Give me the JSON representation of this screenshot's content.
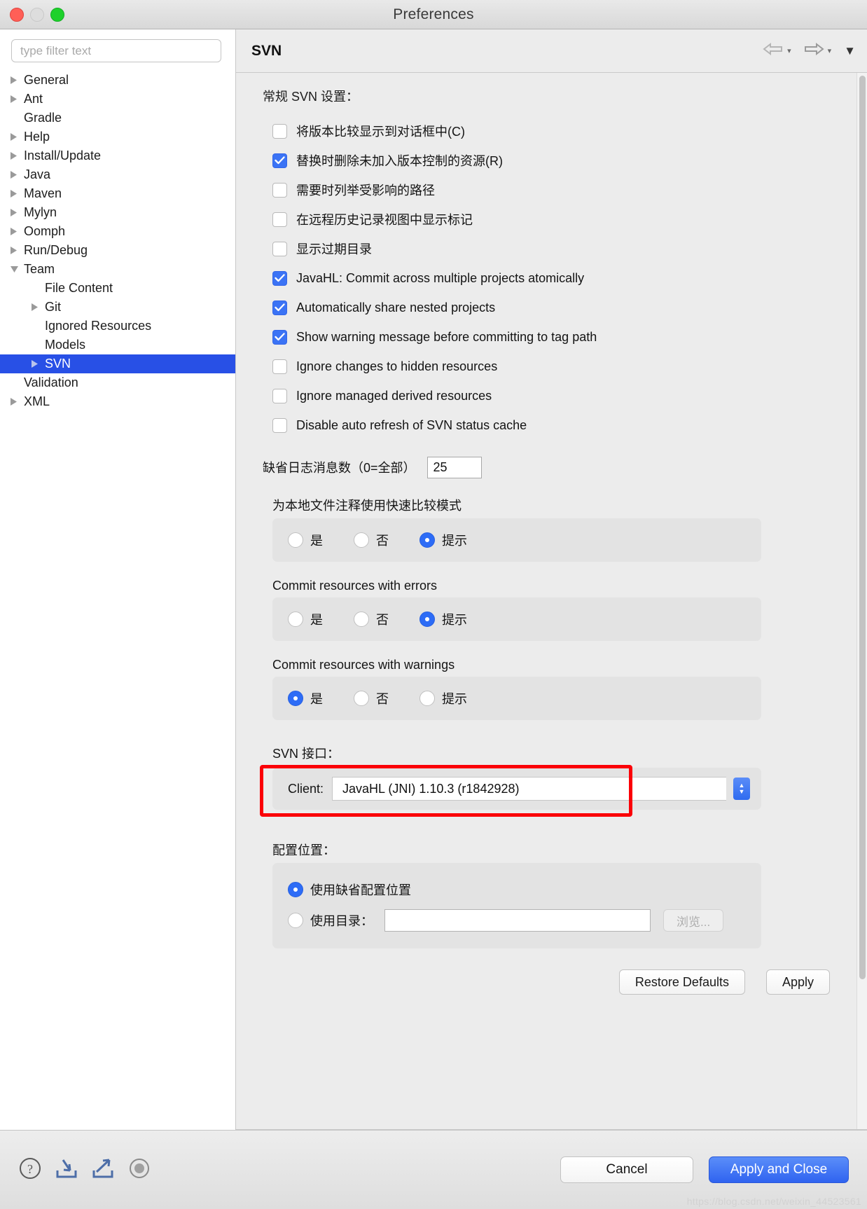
{
  "window": {
    "title": "Preferences",
    "traffic_lights": [
      "close",
      "minimize",
      "zoom"
    ]
  },
  "sidebar": {
    "filter_placeholder": "type filter text",
    "filter_value": "",
    "items": [
      {
        "label": "General",
        "indent": 0,
        "twisty": "collapsed",
        "selected": false
      },
      {
        "label": "Ant",
        "indent": 0,
        "twisty": "collapsed",
        "selected": false
      },
      {
        "label": "Gradle",
        "indent": 0,
        "twisty": "none",
        "selected": false
      },
      {
        "label": "Help",
        "indent": 0,
        "twisty": "collapsed",
        "selected": false
      },
      {
        "label": "Install/Update",
        "indent": 0,
        "twisty": "collapsed",
        "selected": false
      },
      {
        "label": "Java",
        "indent": 0,
        "twisty": "collapsed",
        "selected": false
      },
      {
        "label": "Maven",
        "indent": 0,
        "twisty": "collapsed",
        "selected": false
      },
      {
        "label": "Mylyn",
        "indent": 0,
        "twisty": "collapsed",
        "selected": false
      },
      {
        "label": "Oomph",
        "indent": 0,
        "twisty": "collapsed",
        "selected": false
      },
      {
        "label": "Run/Debug",
        "indent": 0,
        "twisty": "collapsed",
        "selected": false
      },
      {
        "label": "Team",
        "indent": 0,
        "twisty": "expanded",
        "selected": false
      },
      {
        "label": "File Content",
        "indent": 1,
        "twisty": "none",
        "selected": false
      },
      {
        "label": "Git",
        "indent": 1,
        "twisty": "collapsed",
        "selected": false
      },
      {
        "label": "Ignored Resources",
        "indent": 1,
        "twisty": "none",
        "selected": false
      },
      {
        "label": "Models",
        "indent": 1,
        "twisty": "none",
        "selected": false
      },
      {
        "label": "SVN",
        "indent": 1,
        "twisty": "collapsed",
        "selected": true
      },
      {
        "label": "Validation",
        "indent": 0,
        "twisty": "none",
        "selected": false
      },
      {
        "label": "XML",
        "indent": 0,
        "twisty": "collapsed",
        "selected": false
      }
    ]
  },
  "page": {
    "title": "SVN",
    "nav": {
      "back": "←",
      "forward": "→",
      "caret": "▾",
      "menu": "▼"
    }
  },
  "main": {
    "section_title": "常规 SVN 设置：",
    "checkboxes": [
      {
        "label": "将版本比较显示到对话框中(C)",
        "checked": false
      },
      {
        "label": "替换时删除未加入版本控制的资源(R)",
        "checked": true
      },
      {
        "label": "需要时列举受影响的路径",
        "checked": false
      },
      {
        "label": "在远程历史记录视图中显示标记",
        "checked": false
      },
      {
        "label": "显示过期目录",
        "checked": false
      },
      {
        "label": "JavaHL: Commit across multiple projects atomically",
        "checked": true
      },
      {
        "label": "Automatically share nested projects",
        "checked": true
      },
      {
        "label": "Show warning message before committing to tag path",
        "checked": true
      },
      {
        "label": "Ignore changes to hidden resources",
        "checked": false
      },
      {
        "label": "Ignore managed derived resources",
        "checked": false
      },
      {
        "label": "Disable auto refresh of SVN status cache",
        "checked": false
      }
    ],
    "log_messages": {
      "label": "缺省日志消息数（0=全部）",
      "value": "25"
    },
    "radio_groups": [
      {
        "label": "为本地文件注释使用快速比较模式",
        "options": [
          {
            "label": "是",
            "selected": false
          },
          {
            "label": "否",
            "selected": false
          },
          {
            "label": "提示",
            "selected": true
          }
        ]
      },
      {
        "label": "Commit resources with errors",
        "options": [
          {
            "label": "是",
            "selected": false
          },
          {
            "label": "否",
            "selected": false
          },
          {
            "label": "提示",
            "selected": true
          }
        ]
      },
      {
        "label": "Commit resources with warnings",
        "options": [
          {
            "label": "是",
            "selected": true
          },
          {
            "label": "否",
            "selected": false
          },
          {
            "label": "提示",
            "selected": false
          }
        ]
      }
    ],
    "svn_interface": {
      "label": "SVN 接口：",
      "client_label": "Client:",
      "client_value": "JavaHL (JNI) 1.10.3 (r1842928)",
      "highlight_color": "#fb0007"
    },
    "config_location": {
      "label": "配置位置：",
      "default_option": "使用缺省配置位置",
      "default_selected": true,
      "dir_option": "使用目录：",
      "dir_selected": false,
      "dir_value": "",
      "browse_label": "浏览..."
    },
    "buttons": {
      "restore_defaults": "Restore Defaults",
      "apply": "Apply"
    }
  },
  "footer": {
    "icons": [
      "help-icon",
      "import-icon",
      "export-icon",
      "record-icon"
    ],
    "cancel": "Cancel",
    "apply_and_close": "Apply and Close",
    "watermark": "https://blog.csdn.net/weixin_44523561"
  },
  "colors": {
    "accent": "#2d6cf6",
    "selection": "#2850e6",
    "highlight": "#fb0007",
    "window_bg": "#ececec"
  }
}
